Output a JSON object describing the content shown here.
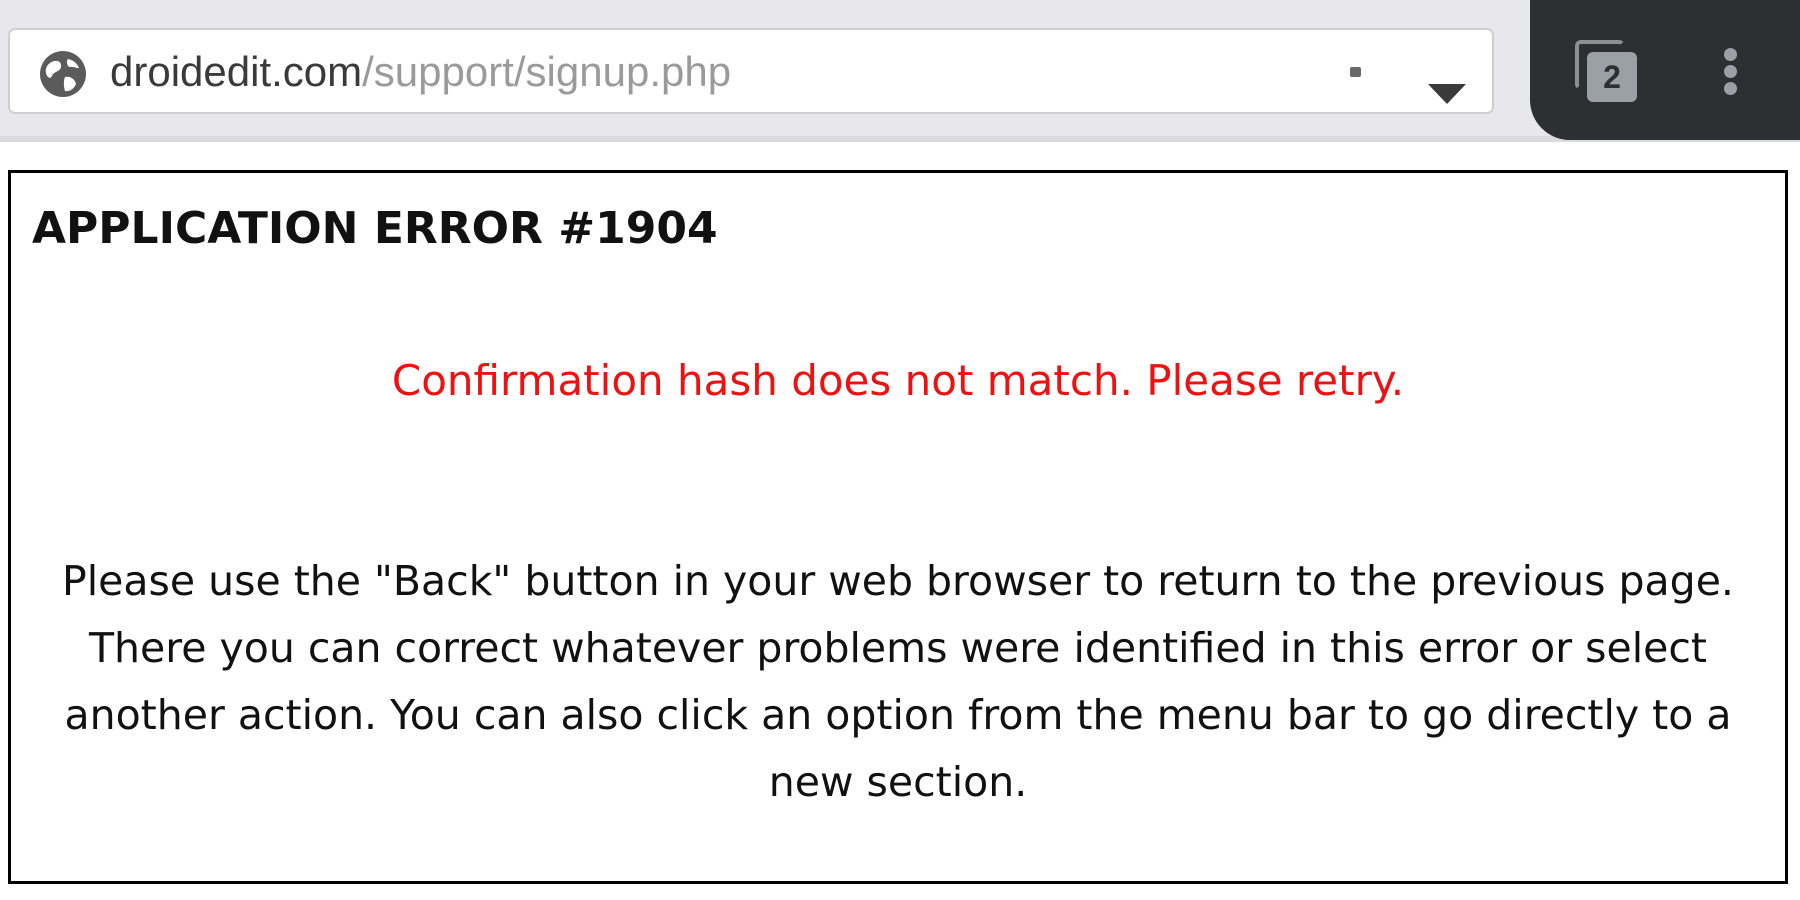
{
  "browser": {
    "url_host": "droidedit.com",
    "url_path": "/support/signup.php",
    "tab_count": "2",
    "icons": {
      "site_info": "globe-icon",
      "dropdown": "chevron-down-icon",
      "tabs": "tab-switcher-icon",
      "menu": "more-vertical-icon"
    },
    "colors": {
      "toolbar": "#e8e8ec",
      "dark_tab": "#2d3033"
    }
  },
  "page": {
    "error_title": "APPLICATION ERROR #1904",
    "error_message": "Confirmation hash does not match. Please retry.",
    "instructions": "Please use the \"Back\" button in your web browser to return to the previous page. There you can correct whatever problems were identified in this error or select another action. You can also click an option from the menu bar to go directly to a new section.",
    "colors": {
      "error_message": "#ee1111",
      "border": "#000000"
    }
  }
}
